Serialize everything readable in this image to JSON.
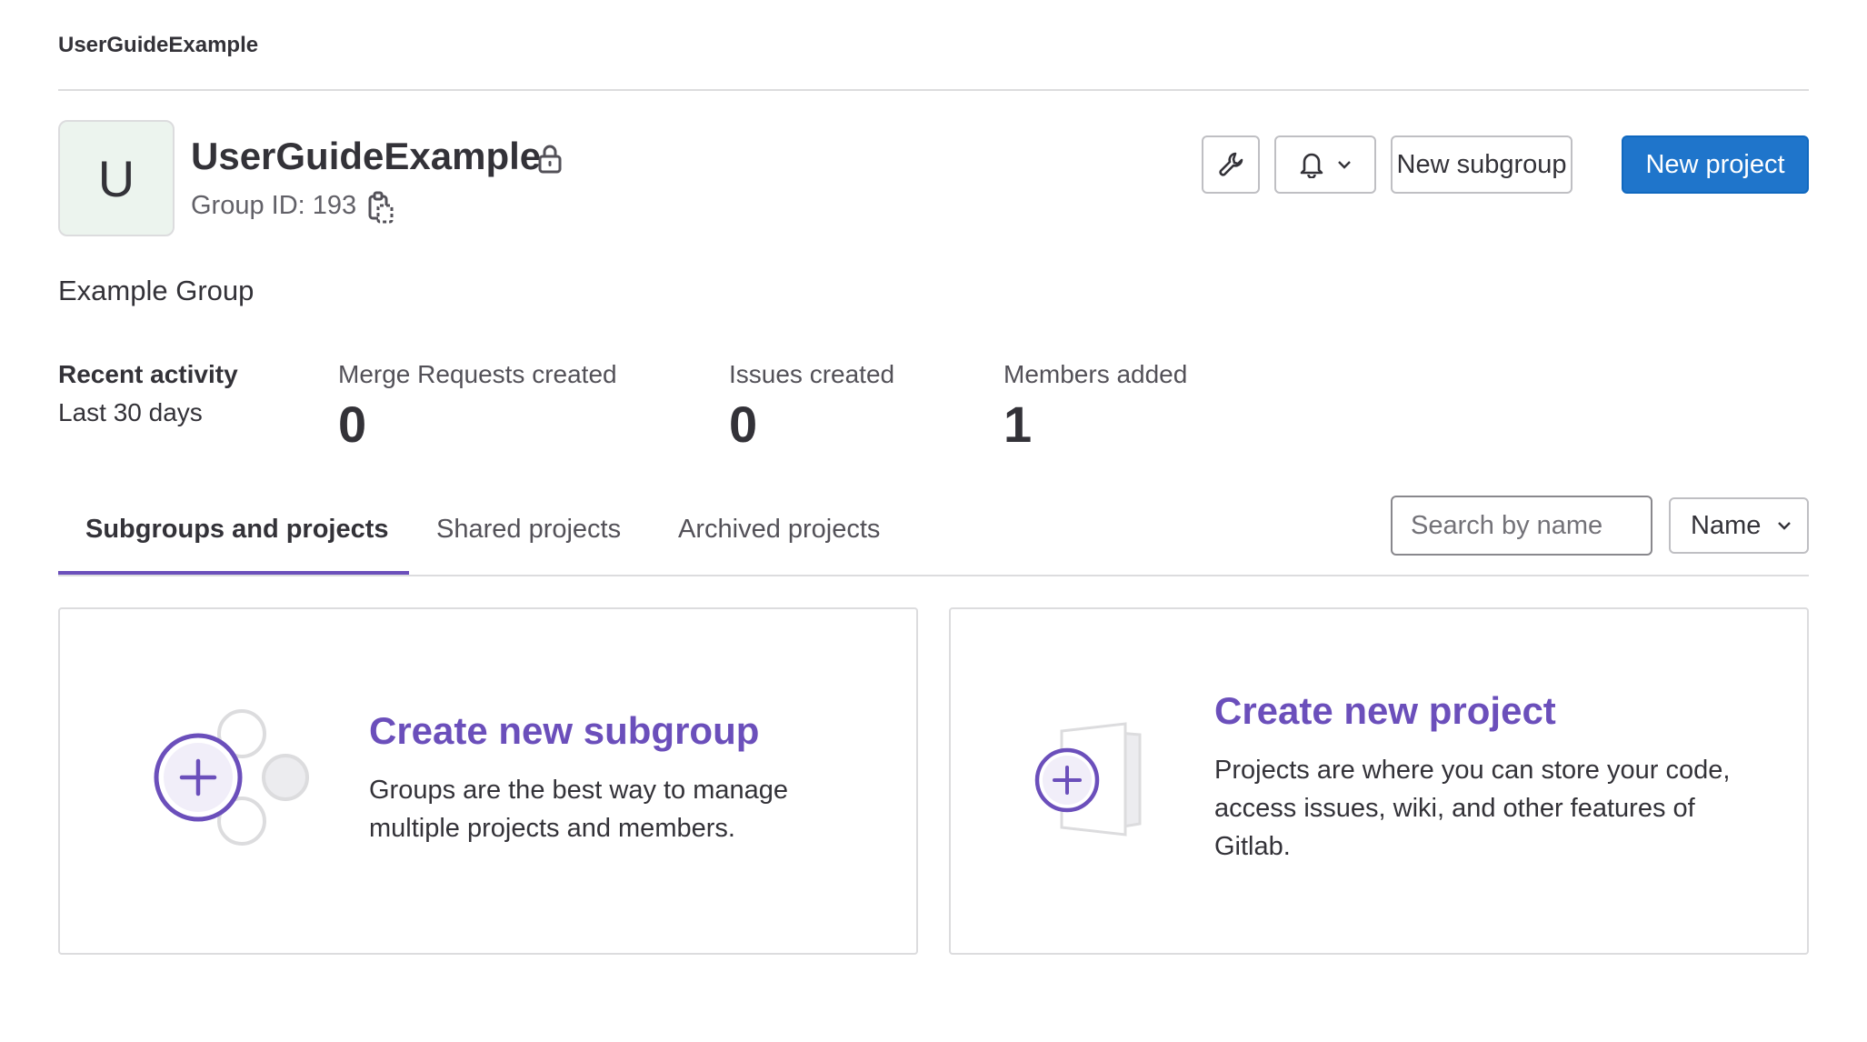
{
  "breadcrumb": {
    "label": "UserGuideExample"
  },
  "group": {
    "avatar_letter": "U",
    "title": "UserGuideExample",
    "id_text": "Group ID: 193",
    "description": "Example Group"
  },
  "header_actions": {
    "wrench_icon": "wrench-icon",
    "bell_icon": "bell-icon",
    "new_subgroup_label": "New subgroup",
    "new_project_label": "New project"
  },
  "activity": {
    "title": "Recent activity",
    "period": "Last 30 days",
    "stats": [
      {
        "label": "Merge Requests created",
        "value": "0"
      },
      {
        "label": "Issues created",
        "value": "0"
      },
      {
        "label": "Members added",
        "value": "1"
      }
    ]
  },
  "tabs": [
    {
      "label": "Subgroups and projects",
      "active": true
    },
    {
      "label": "Shared projects",
      "active": false
    },
    {
      "label": "Archived projects",
      "active": false
    }
  ],
  "search": {
    "placeholder": "Search by name",
    "value": ""
  },
  "sort": {
    "selected": "Name"
  },
  "cards": {
    "subgroup": {
      "title": "Create new subgroup",
      "text": "Groups are the best way to manage multiple projects and members."
    },
    "project": {
      "title": "Create new project",
      "text": "Projects are where you can store your code, access issues, wiki, and other features of Gitlab."
    }
  },
  "colors": {
    "accent_purple": "#6b4fbb",
    "primary_blue": "#1f75cb",
    "avatar_bg": "#ecf4ee"
  }
}
